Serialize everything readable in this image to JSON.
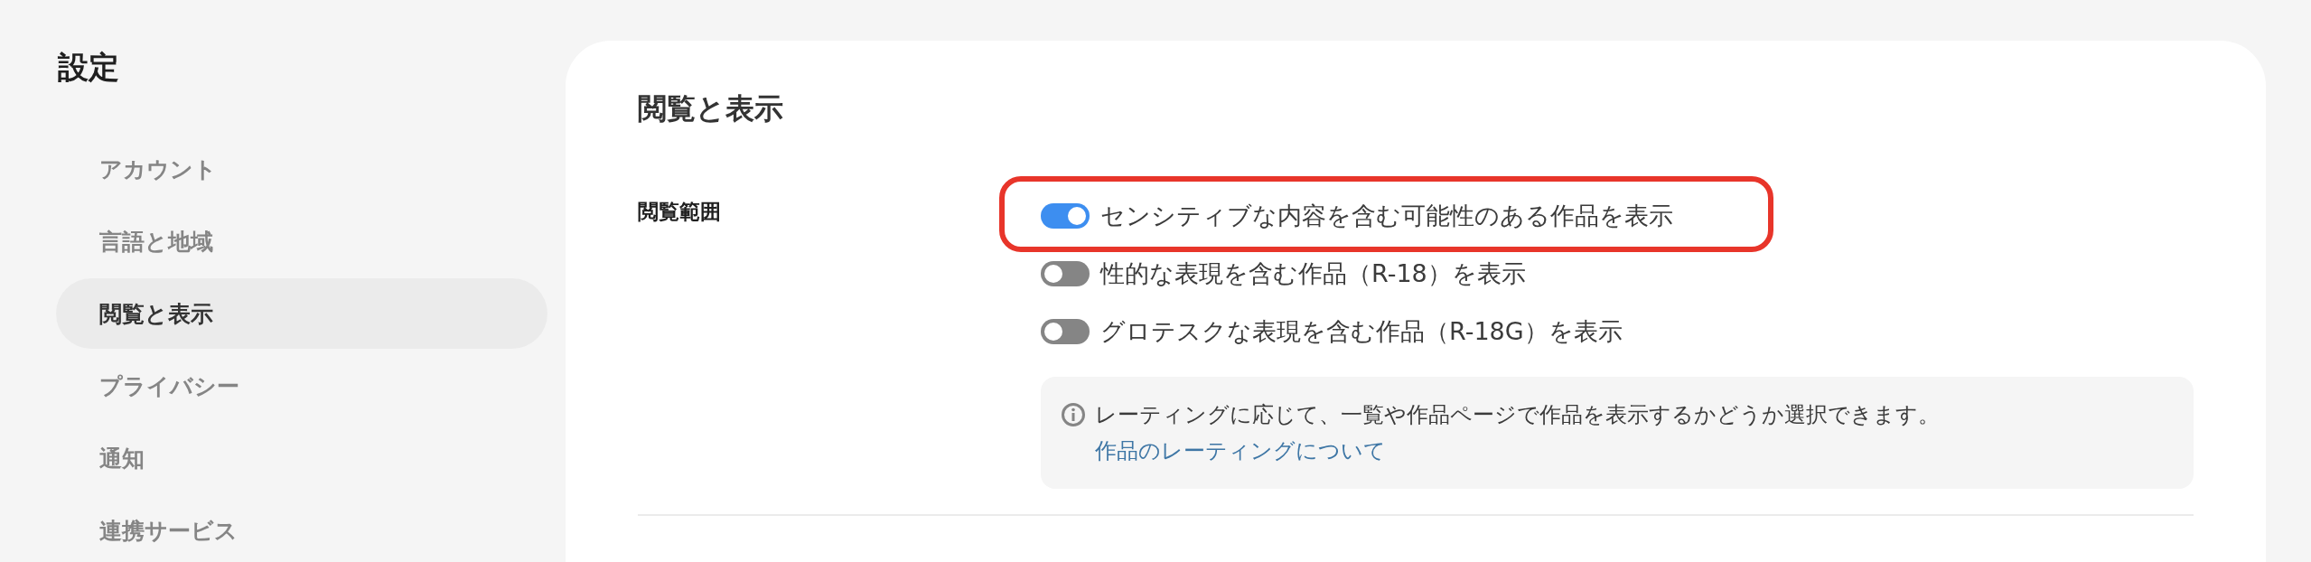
{
  "sidebar": {
    "title": "設定",
    "items": [
      {
        "label": "アカウント",
        "selected": false
      },
      {
        "label": "言語と地域",
        "selected": false
      },
      {
        "label": "閲覧と表示",
        "selected": true
      },
      {
        "label": "プライバシー",
        "selected": false
      },
      {
        "label": "通知",
        "selected": false
      },
      {
        "label": "連携サービス",
        "selected": false
      }
    ]
  },
  "panel": {
    "title": "閲覧と表示",
    "section": {
      "label": "閲覧範囲",
      "toggles": [
        {
          "label": "センシティブな内容を含む可能性のある作品を表示",
          "on": true,
          "highlighted": true
        },
        {
          "label": "性的な表現を含む作品（R-18）を表示",
          "on": false,
          "highlighted": false
        },
        {
          "label": "グロテスクな表現を含む作品（R-18G）を表示",
          "on": false,
          "highlighted": false
        }
      ],
      "note": {
        "text": "レーティングに応じて、一覧や作品ページで作品を表示するかどうか選択できます。",
        "link": "作品のレーティングについて"
      }
    }
  }
}
